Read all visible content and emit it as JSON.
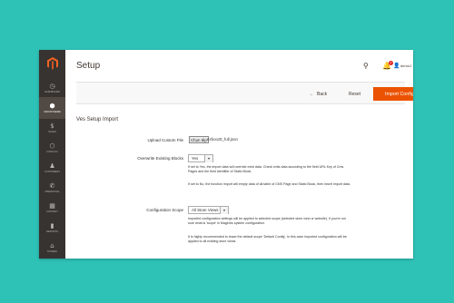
{
  "sidebar": {
    "items": [
      {
        "label": "DASHBOARD",
        "icon": "dashboard-icon",
        "glyph": "◷"
      },
      {
        "label": "VENUSTHEME",
        "icon": "venustheme-icon",
        "glyph": "⬢"
      },
      {
        "label": "SALES",
        "icon": "sales-icon",
        "glyph": "$"
      },
      {
        "label": "CATALOG",
        "icon": "catalog-icon",
        "glyph": "⬡"
      },
      {
        "label": "CUSTOMERS",
        "icon": "customers-icon",
        "glyph": "♟"
      },
      {
        "label": "MARKETING",
        "icon": "marketing-icon",
        "glyph": "✆"
      },
      {
        "label": "CONTENT",
        "icon": "content-icon",
        "glyph": "▦"
      },
      {
        "label": "REPORTS",
        "icon": "reports-icon",
        "glyph": "▮"
      },
      {
        "label": "STORES",
        "icon": "stores-icon",
        "glyph": "⌂"
      }
    ]
  },
  "header": {
    "title": "Setup",
    "notification_count": "1",
    "user_name": "demo1",
    "search_glyph": "⚲",
    "bell_glyph": "🔔",
    "user_glyph": "👤",
    "caret_glyph": "▾"
  },
  "actions": {
    "back_label": "Back",
    "back_arrow": "←",
    "reset_label": "Reset",
    "import_label": "Import Configuration"
  },
  "form": {
    "section_title": "Ves Setup Import",
    "upload_label": "Upload Custom File",
    "file_button_label": "Chọn tệp",
    "file_name": "ezbooztt_full.json",
    "overwrite_label": "Overwrite Existing Blocks",
    "overwrite_value": "Yes",
    "overwrite_note_1": "If set to Yes, the import data will override exist data. Check exits data according to the field URL Key of Cms Pages and the field Identifier of Static Block.",
    "overwrite_note_2": "If set to No, the function import will empty data of all table of CMS Page and Static Block, then insert import data.",
    "scope_label": "Configuration Scope",
    "scope_value": "All Store Views",
    "scope_note_1": "Imported configuration settings will be applied to selected scope (selected store view or website). If you're not sure what is 'scope' in Magento system configuration.",
    "scope_note_2": "It is highly recommended to leave the default scope 'Default Config'. In this case imported configuration will be applied to all existing store views."
  },
  "colors": {
    "background": "#2ec2b7",
    "sidebar": "#373330",
    "accent": "#eb5202",
    "logo": "#f26322"
  }
}
